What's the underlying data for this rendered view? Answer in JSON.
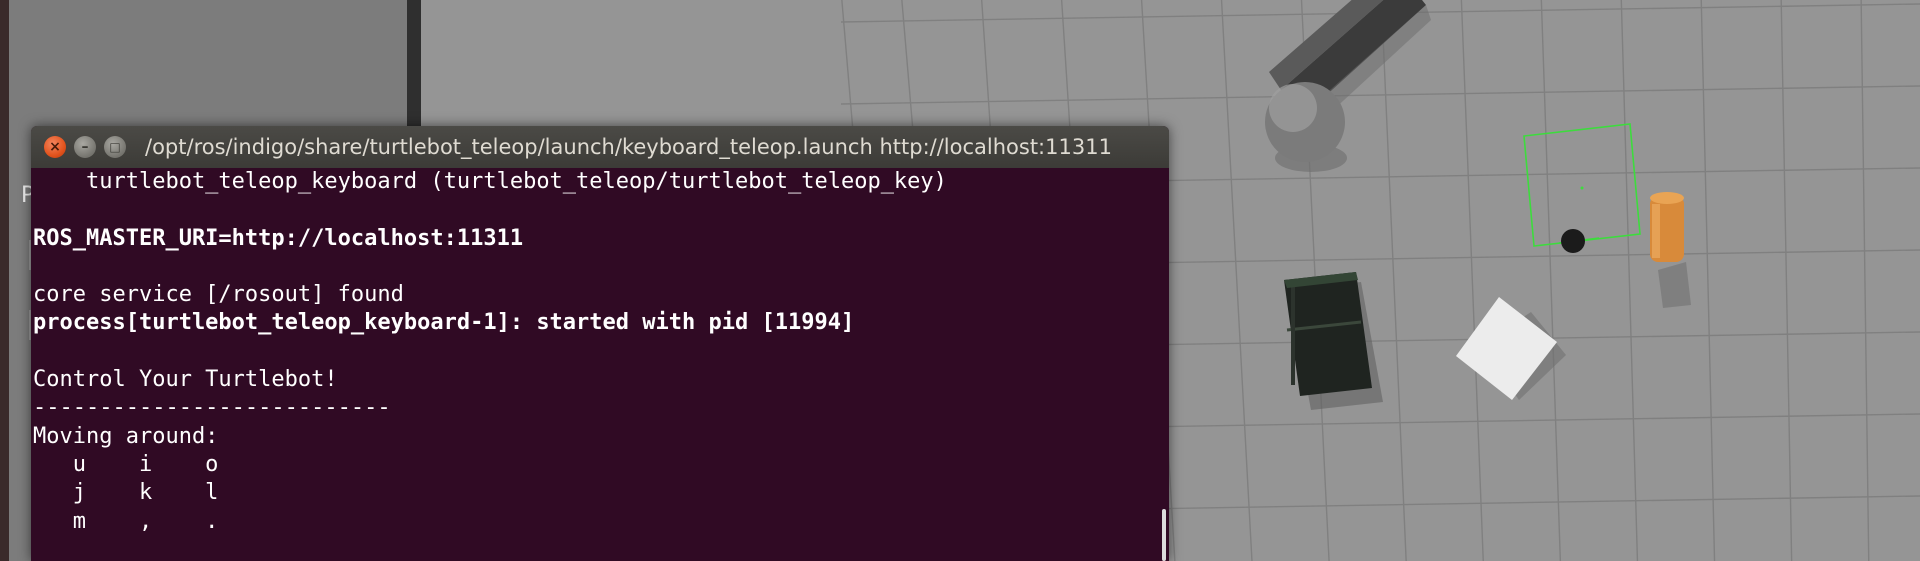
{
  "left_panel": {
    "letter": "P"
  },
  "terminal": {
    "title": "/opt/ros/indigo/share/turtlebot_teleop/launch/keyboard_teleop.launch http://localhost:11311",
    "buttons": {
      "close": "×",
      "minimize": "–",
      "maximize": "□"
    },
    "lines": [
      {
        "text": "    turtlebot_teleop_keyboard (turtlebot_teleop/turtlebot_teleop_key)",
        "bold": false
      },
      {
        "text": "",
        "bold": false
      },
      {
        "text": "ROS_MASTER_URI=http://localhost:11311",
        "bold": true
      },
      {
        "text": "",
        "bold": false
      },
      {
        "text": "core service [/rosout] found",
        "bold": false
      },
      {
        "text": "process[turtlebot_teleop_keyboard-1]: started with pid [11994]",
        "bold": true
      },
      {
        "text": "",
        "bold": false
      },
      {
        "text": "Control Your Turtlebot!",
        "bold": false
      },
      {
        "text": "---------------------------",
        "bold": false
      },
      {
        "text": "Moving around:",
        "bold": false
      },
      {
        "text": "   u    i    o",
        "bold": false
      },
      {
        "text": "   j    k    l",
        "bold": false
      },
      {
        "text": "   m    ,    .",
        "bold": false
      }
    ]
  },
  "scene": {
    "ground_color": "#959595",
    "grid_color": "#7f7f7f",
    "objects": [
      "gray-beam",
      "gray-sphere",
      "bookshelf",
      "white-box",
      "orange-cylinder",
      "turtlebot-marker",
      "selection-box"
    ]
  },
  "colors": {
    "terminal_bg": "#300a24",
    "terminal_text": "#ffffff",
    "titlebar": "#3c3b37",
    "close_button": "#e2531d",
    "selection_green": "#3ddc3d"
  }
}
